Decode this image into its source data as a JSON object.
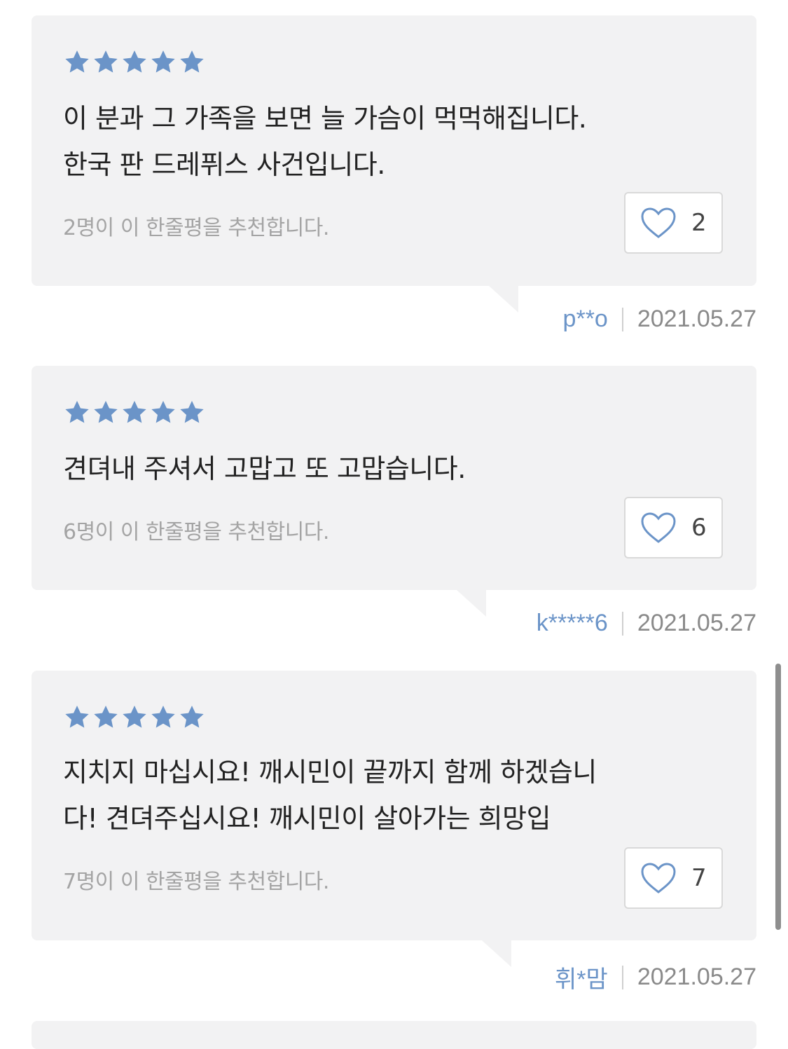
{
  "colors": {
    "card_bg": "#f2f2f3",
    "star": "#6b94c8",
    "username": "#6b94c8",
    "date": "#8a8a8a",
    "recommend_text": "#a4a4a4"
  },
  "reviews": [
    {
      "rating": 5,
      "comment_lines": [
        "이 분과 그 가족을 보면 늘 가슴이 먹먹해집니다.",
        "한국 판 드레퓌스 사건입니다."
      ],
      "recommend_text": "2명이 이 한줄평을 추천합니다.",
      "likes": "2",
      "username": "p**o",
      "date": "2021.05.27",
      "like_icon": "heart-outline-icon"
    },
    {
      "rating": 5,
      "comment_lines": [
        "견뎌내 주셔서 고맙고 또 고맙습니다."
      ],
      "recommend_text": "6명이 이 한줄평을 추천합니다.",
      "likes": "6",
      "username": "k*****6",
      "date": "2021.05.27",
      "like_icon": "heart-outline-icon"
    },
    {
      "rating": 5,
      "comment_lines": [
        "지치지 마십시요! 깨시민이 끝까지 함께 하겠습니",
        "다! 견뎌주십시요! 깨시민이 살아가는 희망입"
      ],
      "recommend_text": "7명이 이 한줄평을 추천합니다.",
      "likes": "7",
      "username": "휘*맘",
      "date": "2021.05.27",
      "like_icon": "heart-outline-icon"
    }
  ]
}
